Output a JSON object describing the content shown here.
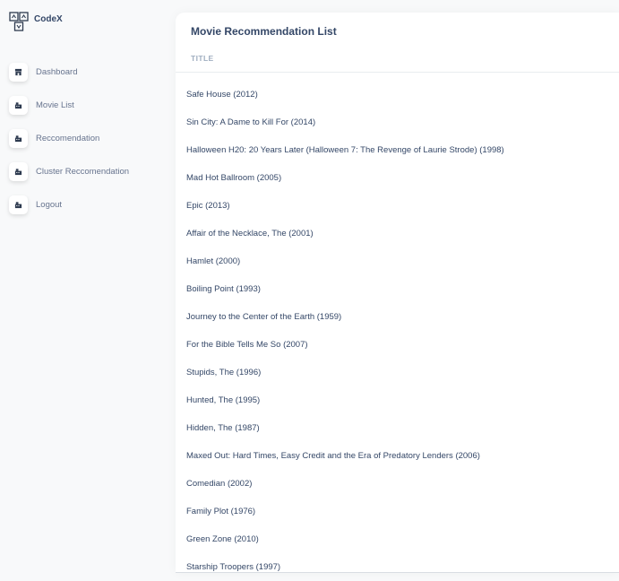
{
  "brand": {
    "name": "CodeX",
    "logo_icon": "codex-logo-icon"
  },
  "sidebar": {
    "items": [
      {
        "label": "Dashboard",
        "icon": "store-icon"
      },
      {
        "label": "Movie List",
        "icon": "building-icon"
      },
      {
        "label": "Reccomendation",
        "icon": "building-icon"
      },
      {
        "label": "Cluster Reccomendation",
        "icon": "building-icon"
      },
      {
        "label": "Logout",
        "icon": "building-icon"
      }
    ]
  },
  "main": {
    "title": "Movie Recommendation List",
    "column_header": "TITLE",
    "movies": [
      "Safe House (2012)",
      "Sin City: A Dame to Kill For (2014)",
      "Halloween H20: 20 Years Later (Halloween 7: The Revenge of Laurie Strode) (1998)",
      "Mad Hot Ballroom (2005)",
      "Epic (2013)",
      "Affair of the Necklace, The (2001)",
      "Hamlet (2000)",
      "Boiling Point (1993)",
      "Journey to the Center of the Earth (1959)",
      "For the Bible Tells Me So (2007)",
      "Stupids, The (1996)",
      "Hunted, The (1995)",
      "Hidden, The (1987)",
      "Maxed Out: Hard Times, Easy Credit and the Era of Predatory Lenders (2006)",
      "Comedian (2002)",
      "Family Plot (1976)",
      "Green Zone (2010)",
      "Starship Troopers (1997)"
    ]
  },
  "colors": {
    "heading": "#344767",
    "nav_text": "#67748e",
    "muted_header": "#a0aec0",
    "icon_dark": "#2d3a4f"
  }
}
